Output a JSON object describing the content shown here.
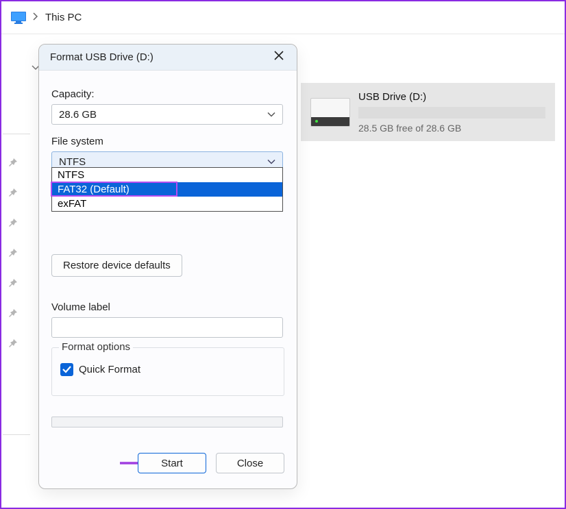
{
  "breadcrumb": {
    "location": "This PC"
  },
  "drive_tile": {
    "name": "USB Drive (D:)",
    "free_text": "28.5 GB free of 28.6 GB"
  },
  "dialog": {
    "title": "Format USB Drive (D:)",
    "capacity_label": "Capacity:",
    "capacity_value": "28.6 GB",
    "filesystem_label": "File system",
    "filesystem_value": "NTFS",
    "filesystem_options": [
      "NTFS",
      "FAT32 (Default)",
      "exFAT"
    ],
    "restore_label": "Restore device defaults",
    "volume_label_label": "Volume label",
    "volume_label_value": "",
    "format_options_legend": "Format options",
    "quick_format_label": "Quick Format",
    "quick_format_checked": true,
    "start_label": "Start",
    "close_label": "Close"
  }
}
